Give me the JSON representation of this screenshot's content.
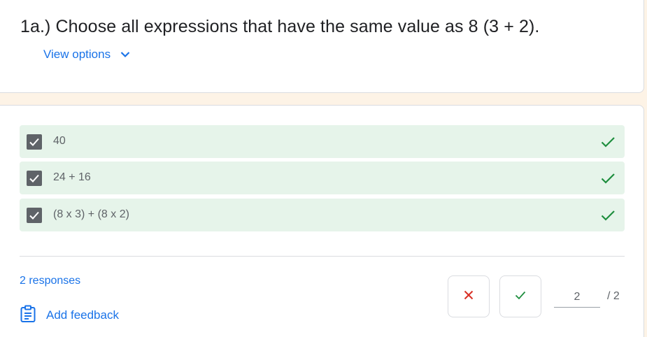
{
  "question": {
    "title": "1a.) Choose all expressions that have the same value as 8 (3 + 2).",
    "view_options_label": "View options"
  },
  "options": [
    {
      "label": "40",
      "checked": true,
      "correct": true
    },
    {
      "label": "24 + 16",
      "checked": true,
      "correct": true
    },
    {
      "label": "(8 x 3) + (8 x 2)",
      "checked": true,
      "correct": true
    }
  ],
  "footer": {
    "responses_label": "2 responses",
    "add_feedback_label": "Add feedback"
  },
  "scoring": {
    "score_value": "2",
    "total_label": "/ 2"
  },
  "colors": {
    "accent": "#1a73e8",
    "correct_bg": "#e6f4ea",
    "correct_mark": "#1e8e3e",
    "incorrect_mark": "#d93025",
    "checkbox": "#5f6368",
    "page_bg": "#fdf3e6"
  },
  "icons": {
    "view_options": "chevron-down-icon",
    "feedback": "clipboard-feedback-icon",
    "mark_incorrect": "close-icon",
    "mark_correct": "check-icon"
  }
}
